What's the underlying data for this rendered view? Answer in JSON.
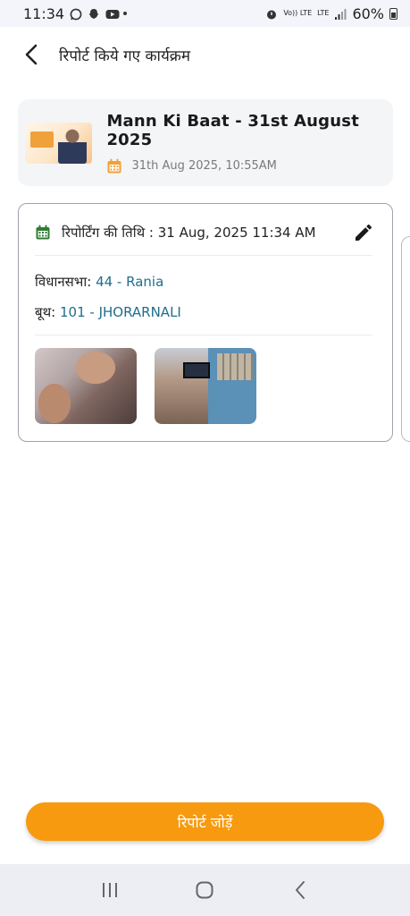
{
  "status_bar": {
    "time": "11:34",
    "network_1": "Vo)) LTE",
    "network_2": "LTE",
    "battery_percent": "60%"
  },
  "header": {
    "title": "रिपोर्ट किये गए कार्यक्रम"
  },
  "program": {
    "title": "Mann Ki Baat - 31st August 2025",
    "date": "31th Aug 2025, 10:55AM",
    "accent_color": "#f0a13a"
  },
  "report": {
    "reporting_date_label": "रिपोर्टिंग की तिथि : 31 Aug, 2025 11:34 AM",
    "assembly_label": "विधानसभा:",
    "assembly_value": "44 - Rania",
    "booth_label": "बूथ:",
    "booth_value": "101 - JHORARNALI",
    "photos": [
      "photo-1",
      "photo-2"
    ],
    "calendar_color": "#2e7d32",
    "value_color": "#1f6e8c"
  },
  "actions": {
    "add_report_label": "रिपोर्ट जोड़ें",
    "button_color": "#f79a0f"
  },
  "nav": {
    "icons": [
      "recent-apps-icon",
      "home-icon",
      "back-icon"
    ]
  }
}
